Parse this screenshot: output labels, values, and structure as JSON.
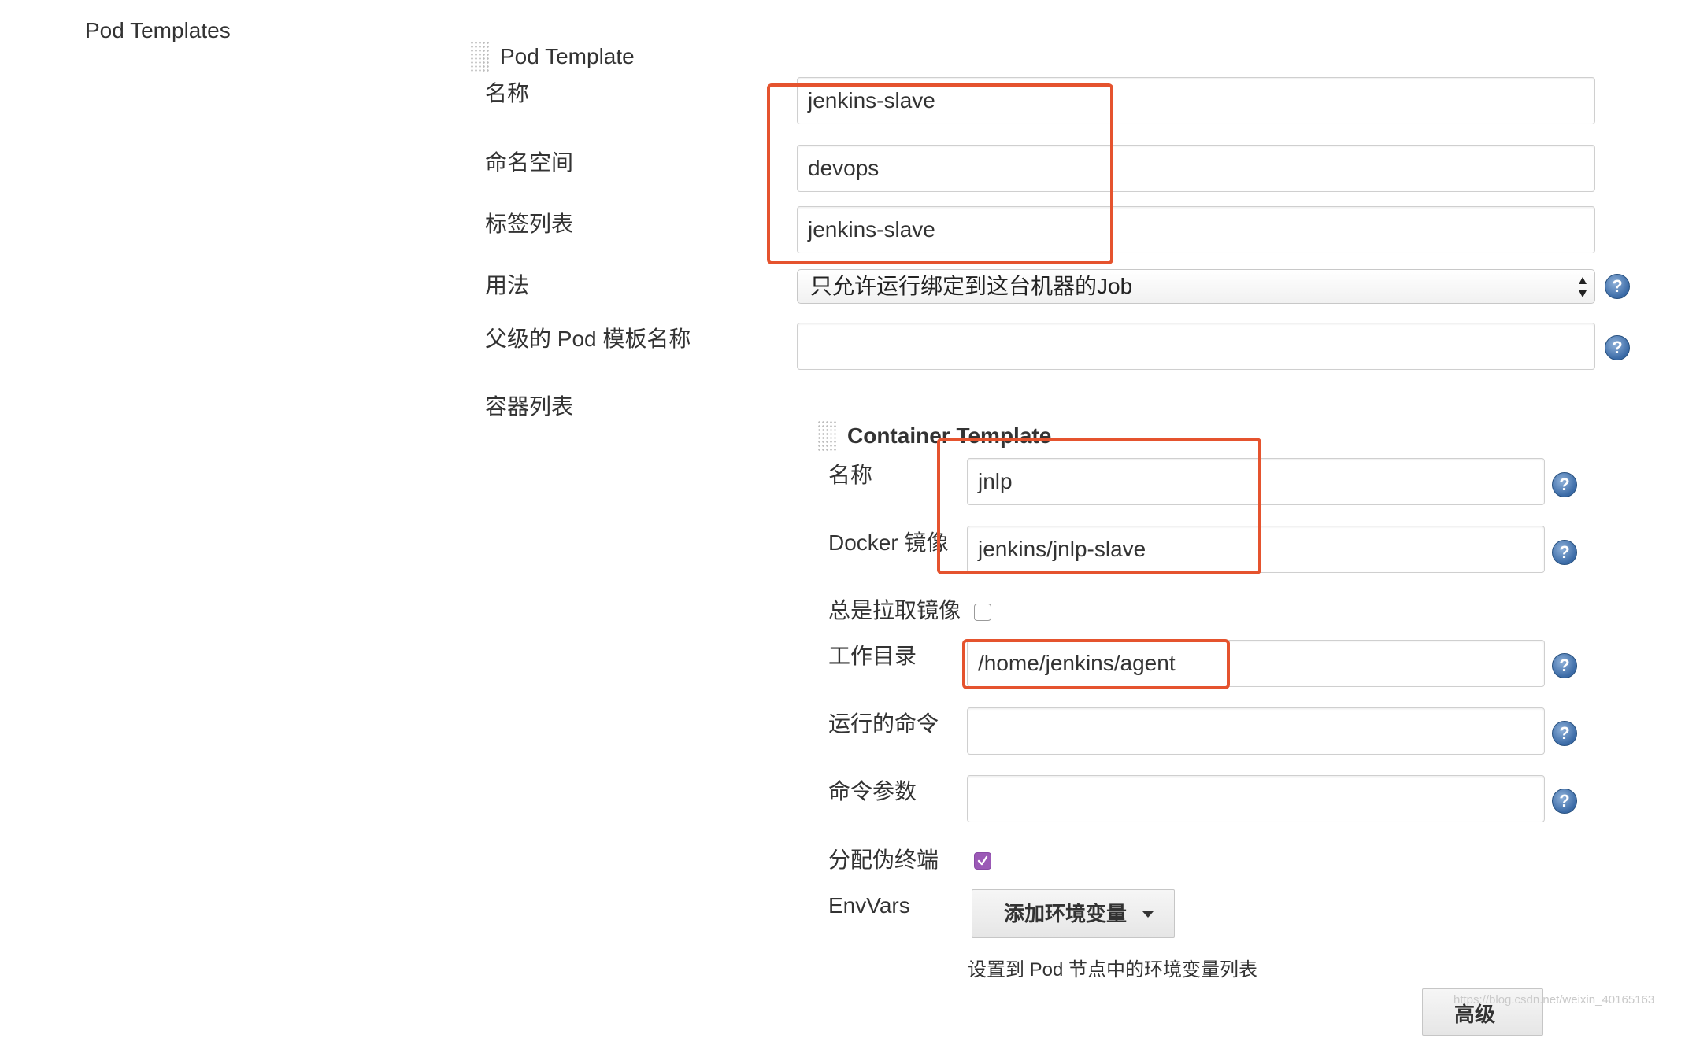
{
  "page": {
    "section_label": "Pod Templates"
  },
  "pod_template": {
    "title": "Pod Template",
    "name": {
      "label": "名称",
      "value": "jenkins-slave"
    },
    "namespace": {
      "label": "命名空间",
      "value": "devops"
    },
    "labels": {
      "label": "标签列表",
      "value": "jenkins-slave"
    },
    "usage": {
      "label": "用法",
      "value": "只允许运行绑定到这台机器的Job"
    },
    "parent": {
      "label": "父级的 Pod 模板名称",
      "value": ""
    },
    "containers_label": "容器列表"
  },
  "container_template": {
    "title": "Container Template",
    "name": {
      "label": "名称",
      "value": "jnlp"
    },
    "image": {
      "label": "Docker 镜像",
      "value": "jenkins/jnlp-slave"
    },
    "always_pull": {
      "label": "总是拉取镜像",
      "checked": false
    },
    "working_dir": {
      "label": "工作目录",
      "value": "/home/jenkins/agent"
    },
    "command": {
      "label": "运行的命令",
      "value": ""
    },
    "args": {
      "label": "命令参数",
      "value": ""
    },
    "tty": {
      "label": "分配伪终端",
      "checked": true
    },
    "envvars": {
      "label": "EnvVars",
      "add_button": "添加环境变量",
      "description": "设置到 Pod 节点中的环境变量列表"
    },
    "advanced_button": "高级"
  },
  "watermark": "https://blog.csdn.net/weixin_40165163",
  "icons": {
    "help": "help-icon",
    "drag": "drag-handle-icon",
    "dropdown": "caret-down-icon",
    "check": "checkmark-icon"
  },
  "colors": {
    "highlight": "#e5532e",
    "checkbox_checked": "#9b59b6",
    "help": "#3a6aa6"
  }
}
